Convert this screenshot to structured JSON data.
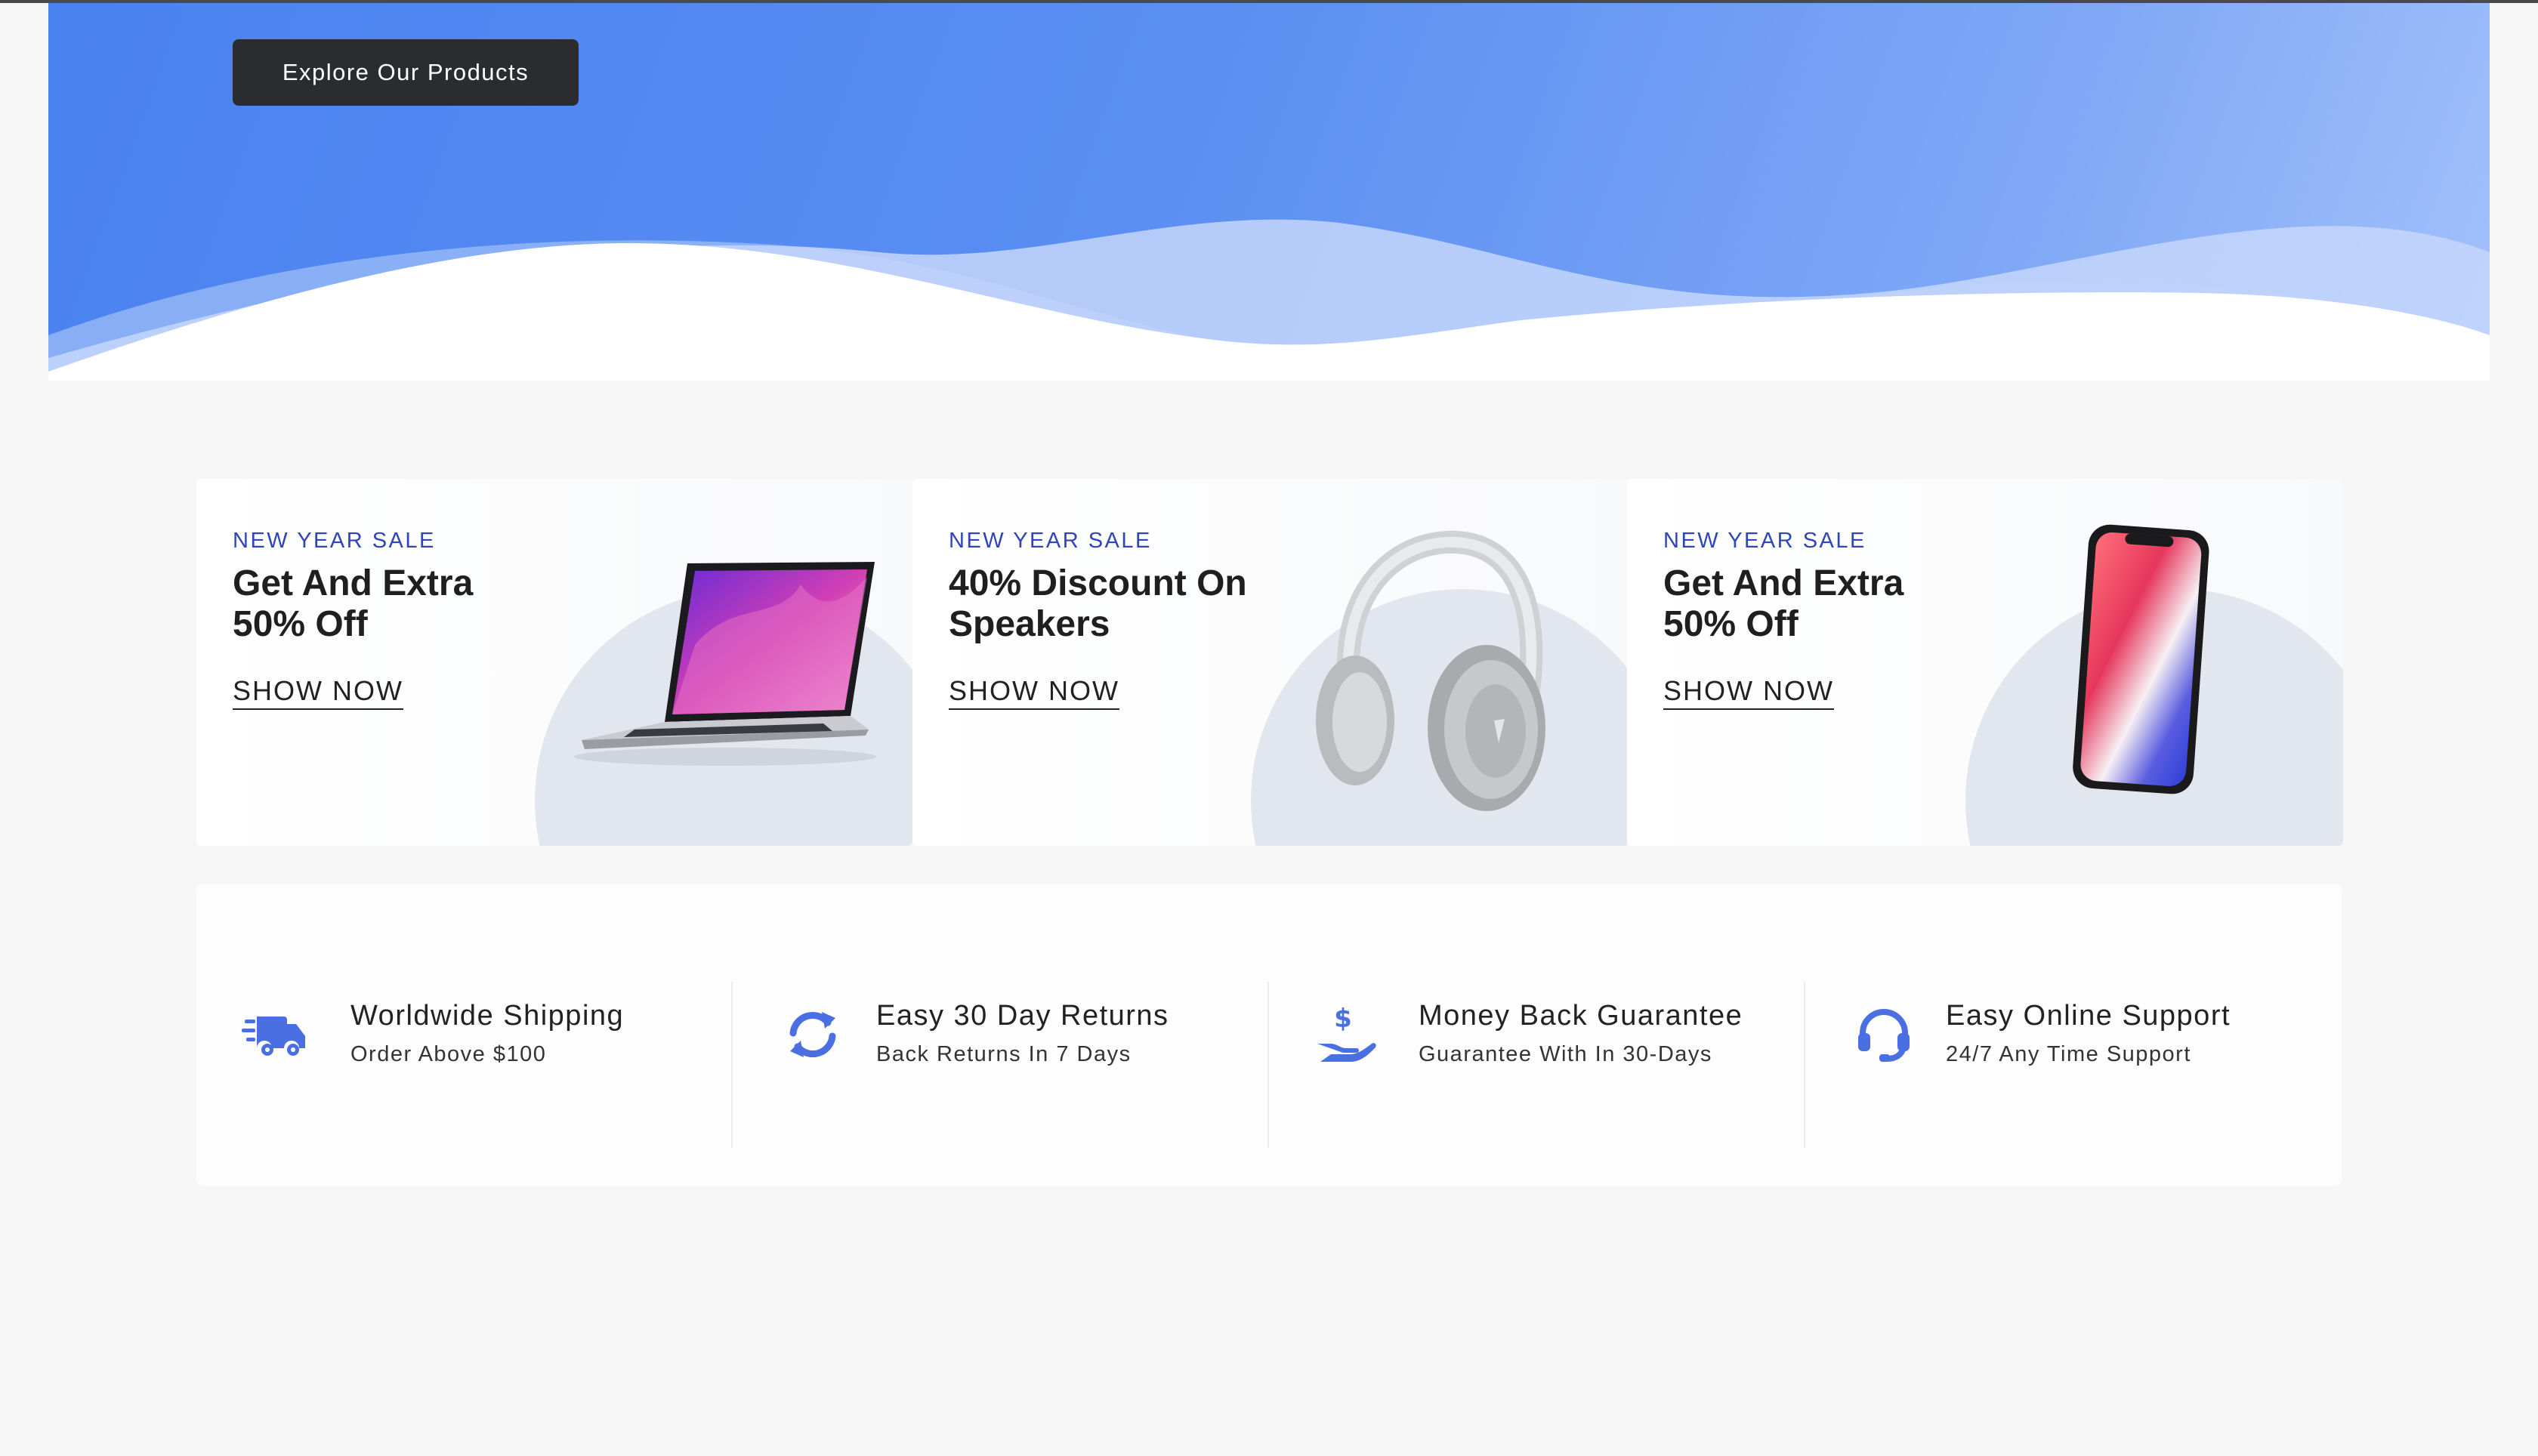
{
  "hero": {
    "cta_label": "Explore Our Products",
    "colors": {
      "start": "#4a82f0",
      "end": "#a3c1fa"
    }
  },
  "promos": [
    {
      "kicker": "NEW YEAR SALE",
      "headline": "Get And Extra 50% Off",
      "cta": "SHOW NOW",
      "image": "laptop"
    },
    {
      "kicker": "NEW YEAR SALE",
      "headline": "40% Discount On Speakers",
      "cta": "SHOW NOW",
      "image": "headphones"
    },
    {
      "kicker": "NEW YEAR SALE",
      "headline": "Get And Extra 50% Off",
      "cta": "SHOW NOW",
      "image": "smartphone"
    }
  ],
  "features": [
    {
      "icon": "shipping-truck-icon",
      "title": "Worldwide Shipping",
      "subtitle": "Order Above $100"
    },
    {
      "icon": "refresh-icon",
      "title": "Easy 30 Day Returns",
      "subtitle": "Back Returns In 7 Days"
    },
    {
      "icon": "money-hand-icon",
      "title": "Money Back Guarantee",
      "subtitle": "Guarantee With In 30-Days"
    },
    {
      "icon": "headset-icon",
      "title": "Easy Online Support",
      "subtitle": "24/7 Any Time Support"
    }
  ],
  "colors": {
    "accent": "#4a6fe3",
    "kicker": "#2f45b8",
    "button_dark": "#2a2c30",
    "page_bg": "#f6f6f6"
  }
}
